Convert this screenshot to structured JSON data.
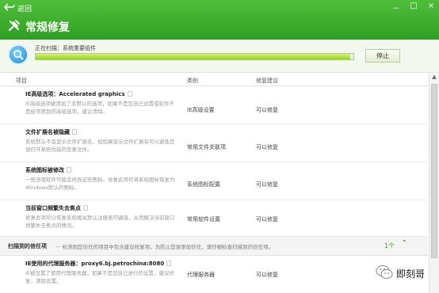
{
  "window": {
    "back_label": "返回",
    "title": "常规修复",
    "controls": [
      "－",
      "□",
      "×"
    ]
  },
  "scan": {
    "status": "正在扫描：系统重要组件",
    "progress": 0.99,
    "stop_label": "停止"
  },
  "table": {
    "headers": {
      "item": "项目",
      "category": "类别",
      "suggestion": "修复建议"
    }
  },
  "rows": [
    {
      "name": "IE高级选项：Accelerated graphics",
      "desc": "IE高级选项被添加了非默认的选项，如果不是您自己设置或软件不是经常用到的高级选项，建议清除。",
      "category": "IE高级设置",
      "suggestion": "可以修复"
    },
    {
      "name": "文件扩展名被隐藏",
      "desc": "系统默认不会显示文件扩展名，但如果显示文件扩展名可以避免您误打开某些伪装的恶意文件。",
      "category": "常用文件关联项",
      "suggestion": "可以修复"
    },
    {
      "name": "系统图标被修改",
      "desc": "一些流氓软件可能会修改这些图标，修复此项可将系统图标恢复为Windows默认的图标。",
      "category": "系统图标配置",
      "suggestion": "可以修复"
    },
    {
      "name": "当前窗口频繁失去焦点",
      "desc": "修复此项可以恢复系统相关默认注册表的键值，从而解决当前窗口频繁失去焦点的情况。",
      "category": "常用软件设置",
      "suggestion": "可以修复"
    }
  ],
  "group": {
    "title": "扫描到的信任项",
    "note": "－ 检测到您信任的项目中包含建议修复项，为防止您误添加信任，请仔细检查扫描到的信任项。",
    "count": "1个",
    "toggle": "⌃"
  },
  "last_row": {
    "name": "IE使用的代理服务器：proxy6.bj.petrochina:8080",
    "desc": "IE被设置了使用代理服务器，如果不是您自己进行的设置，建议修复，清除设置。",
    "category": "代理服务器",
    "suggestion": "可以修复"
  },
  "scrollbar": {
    "up_arrow": "▲"
  },
  "watermark": {
    "text": "即刻哥"
  },
  "colors": {
    "header_green": "#3aaf2a",
    "progress_fill": "#a6dd33",
    "accent_green": "#3a9a20"
  }
}
